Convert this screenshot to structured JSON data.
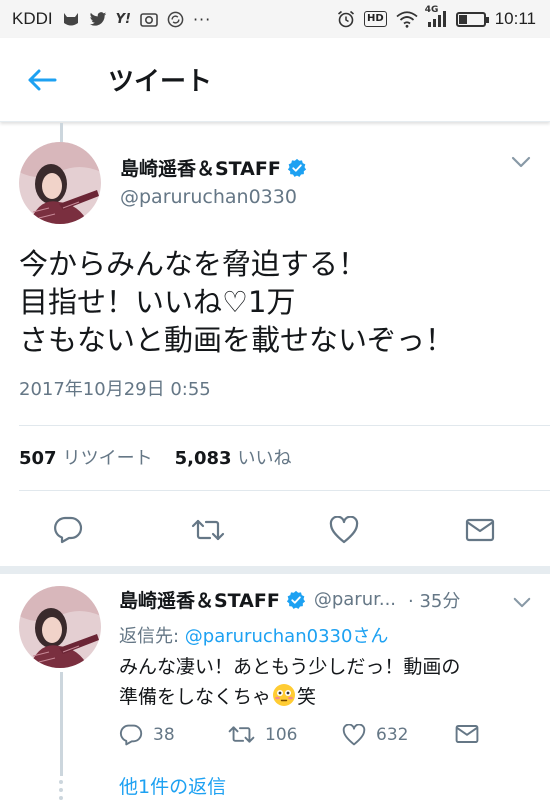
{
  "status_bar": {
    "carrier": "KDDI",
    "left_icons": [
      "cat-icon",
      "twitter-icon",
      "y-news-icon",
      "camera-app-icon",
      "sync-icon",
      "more-dots-icon"
    ],
    "hd": "HD",
    "network": "4G",
    "battery_level": 0.3,
    "time": "10:11"
  },
  "header": {
    "title": "ツイート",
    "accent_color": "#1da1f2"
  },
  "main_tweet": {
    "author_name": "島崎遥香＆STAFF",
    "handle": "@paruruchan0330",
    "text_lines": [
      "今からみんなを脅迫する！",
      "目指せ！いいね♡1万",
      "さもないと動画を載せないぞっ！"
    ],
    "timestamp": "2017年10月29日 0:55",
    "retweet_count": "507",
    "retweet_label": "リツイート",
    "like_count": "5,083",
    "like_label": "いいね"
  },
  "reply_tweet": {
    "author_name": "島崎遥香＆STAFF",
    "handle_truncated": "@parur...",
    "time_ago": "· 35分",
    "reply_to_prefix": "返信先: ",
    "reply_to_handle": "@paruruchan0330さん",
    "text_line1": "みんな凄い！あともう少しだっ！動画の",
    "text_line2_before": "準備をしなくちゃ",
    "text_line2_after": "笑",
    "reply_count": "38",
    "retweet_count": "106",
    "like_count": "632"
  },
  "more_replies": "他1件の返信"
}
